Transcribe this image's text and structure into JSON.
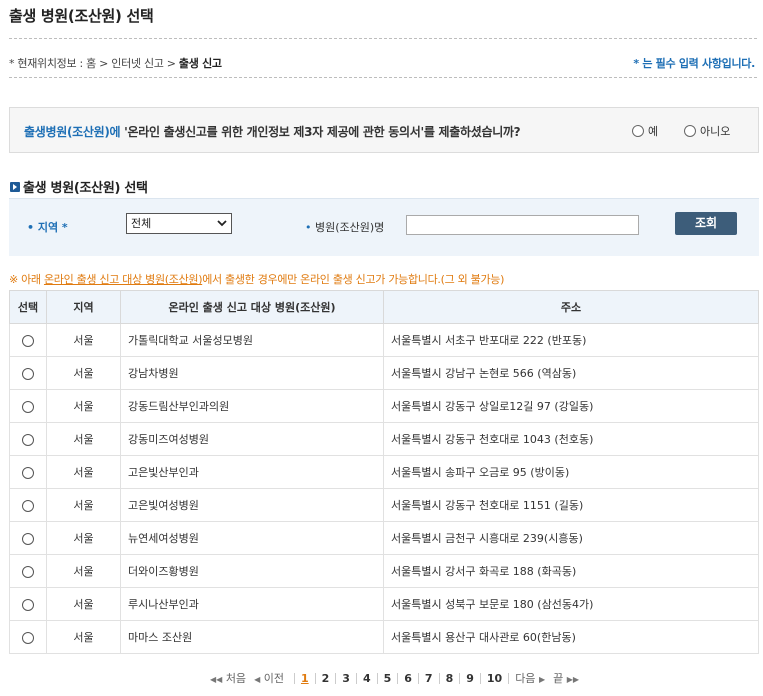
{
  "page": {
    "title": "출생 병원(조산원) 선택"
  },
  "breadcrumb": {
    "label": "* 현재위치정보 :",
    "home": "홈",
    "level1": "인터넷 신고",
    "current": "출생 신고",
    "separator": ">"
  },
  "required_note": "* 는 필수 입력 사항입니다.",
  "consent": {
    "question_hl": "출생병원(조산원)에",
    "question_rest": " '온라인 출생신고를 위한 개인정보 제3자 제공에 관한 동의서'를 제출하셨습니까?",
    "yes_label": "예",
    "no_label": "아니오"
  },
  "search": {
    "section_title": "출생 병원(조산원) 선택",
    "region_label": "• 지역 *",
    "region_value": "전체",
    "hospital_label": "병원(조산원)명",
    "hospital_value": "",
    "button_label": "조회"
  },
  "notice": {
    "prefix": "※ 아래 ",
    "underlined": "온라인 출생 신고 대상 병원(조산원)",
    "suffix": "에서 출생한 경우에만 온라인 출생 신고가 가능합니다.(그 외 불가능)"
  },
  "table": {
    "headers": [
      "선택",
      "지역",
      "온라인 출생 신고 대상 병원(조산원)",
      "주소"
    ],
    "rows": [
      {
        "region": "서울",
        "name": "가톨릭대학교 서울성모병원",
        "address": "서울특별시 서초구 반포대로 222 (반포동)"
      },
      {
        "region": "서울",
        "name": "강남차병원",
        "address": "서울특별시 강남구 논현로 566 (역삼동)"
      },
      {
        "region": "서울",
        "name": "강동드림산부인과의원",
        "address": "서울특별시 강동구 상일로12길 97 (강일동)"
      },
      {
        "region": "서울",
        "name": "강동미즈여성병원",
        "address": "서울특별시 강동구 천호대로 1043 (천호동)"
      },
      {
        "region": "서울",
        "name": "고은빛산부인과",
        "address": "서울특별시 송파구 오금로 95 (방이동)"
      },
      {
        "region": "서울",
        "name": "고은빛여성병원",
        "address": "서울특별시 강동구 천호대로 1151 (길동)"
      },
      {
        "region": "서울",
        "name": "뉴연세여성병원",
        "address": "서울특별시 금천구 시흥대로 239(시흥동)"
      },
      {
        "region": "서울",
        "name": "더와이즈황병원",
        "address": "서울특별시 강서구 화곡로 188 (화곡동)"
      },
      {
        "region": "서울",
        "name": "루시나산부인과",
        "address": "서울특별시 성북구 보문로 180 (삼선동4가)"
      },
      {
        "region": "서울",
        "name": "마마스 조산원",
        "address": "서울특별시 용산구 대사관로 60(한남동)"
      }
    ]
  },
  "pagination": {
    "first": "처음",
    "prev": "이전",
    "next": "다음",
    "last": "끝",
    "pages": [
      "1",
      "2",
      "3",
      "4",
      "5",
      "6",
      "7",
      "8",
      "9",
      "10"
    ],
    "current": "1"
  },
  "colors": {
    "accent_blue": "#1e6fb5",
    "notice_orange": "#e07b10",
    "button_bg": "#3d5d7a",
    "header_bg": "#eef4fa"
  }
}
